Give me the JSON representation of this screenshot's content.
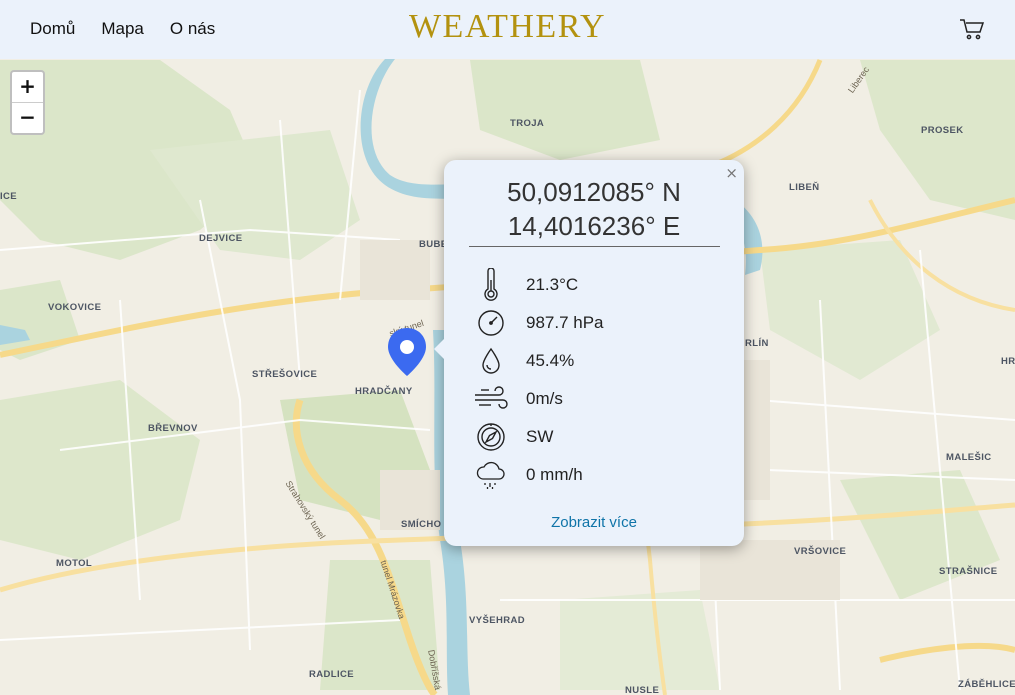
{
  "nav": {
    "home": "Domů",
    "map": "Mapa",
    "about": "O nás"
  },
  "brand": "WEATHERY",
  "icons": {
    "cart": "cart-icon",
    "marker": "map-marker-icon"
  },
  "zoom": {
    "in": "+",
    "out": "−"
  },
  "popup": {
    "close": "×",
    "latitude": "50,0912085° N",
    "longitude": "14,4016236° E",
    "temperature": "21.3°C",
    "pressure": "987.7 hPa",
    "humidity": "45.4%",
    "wind_speed": "0m/s",
    "wind_direction": "SW",
    "precipitation": "0 mm/h",
    "more_link": "Zobrazit více"
  },
  "map": {
    "districts": [
      "TROJA",
      "PROSEK",
      "LIBEŇ",
      "DEJVICE",
      "BUBE",
      "VOKOVICE",
      "STŘEŠOVICE",
      "HRADČANY",
      "BŘEVNOV",
      "SMÍCHO",
      "MOTOL",
      "VYŠEHRAD",
      "RADLICE",
      "NUSLE",
      "VRŠOVICE",
      "STRAŠNICE",
      "MALEŠIC",
      "ZÁBĚHLICE",
      "ICE",
      "HR",
      "RLÍN"
    ],
    "roads": [
      "Strahovský tunel",
      "tunel Mrázovka",
      "Dobříšská",
      "Liberec",
      "ský tunel"
    ]
  },
  "colors": {
    "brand": "#b3920f",
    "header_bg": "#ebf2fb",
    "link": "#0f74a8",
    "marker": "#3b6af0"
  }
}
